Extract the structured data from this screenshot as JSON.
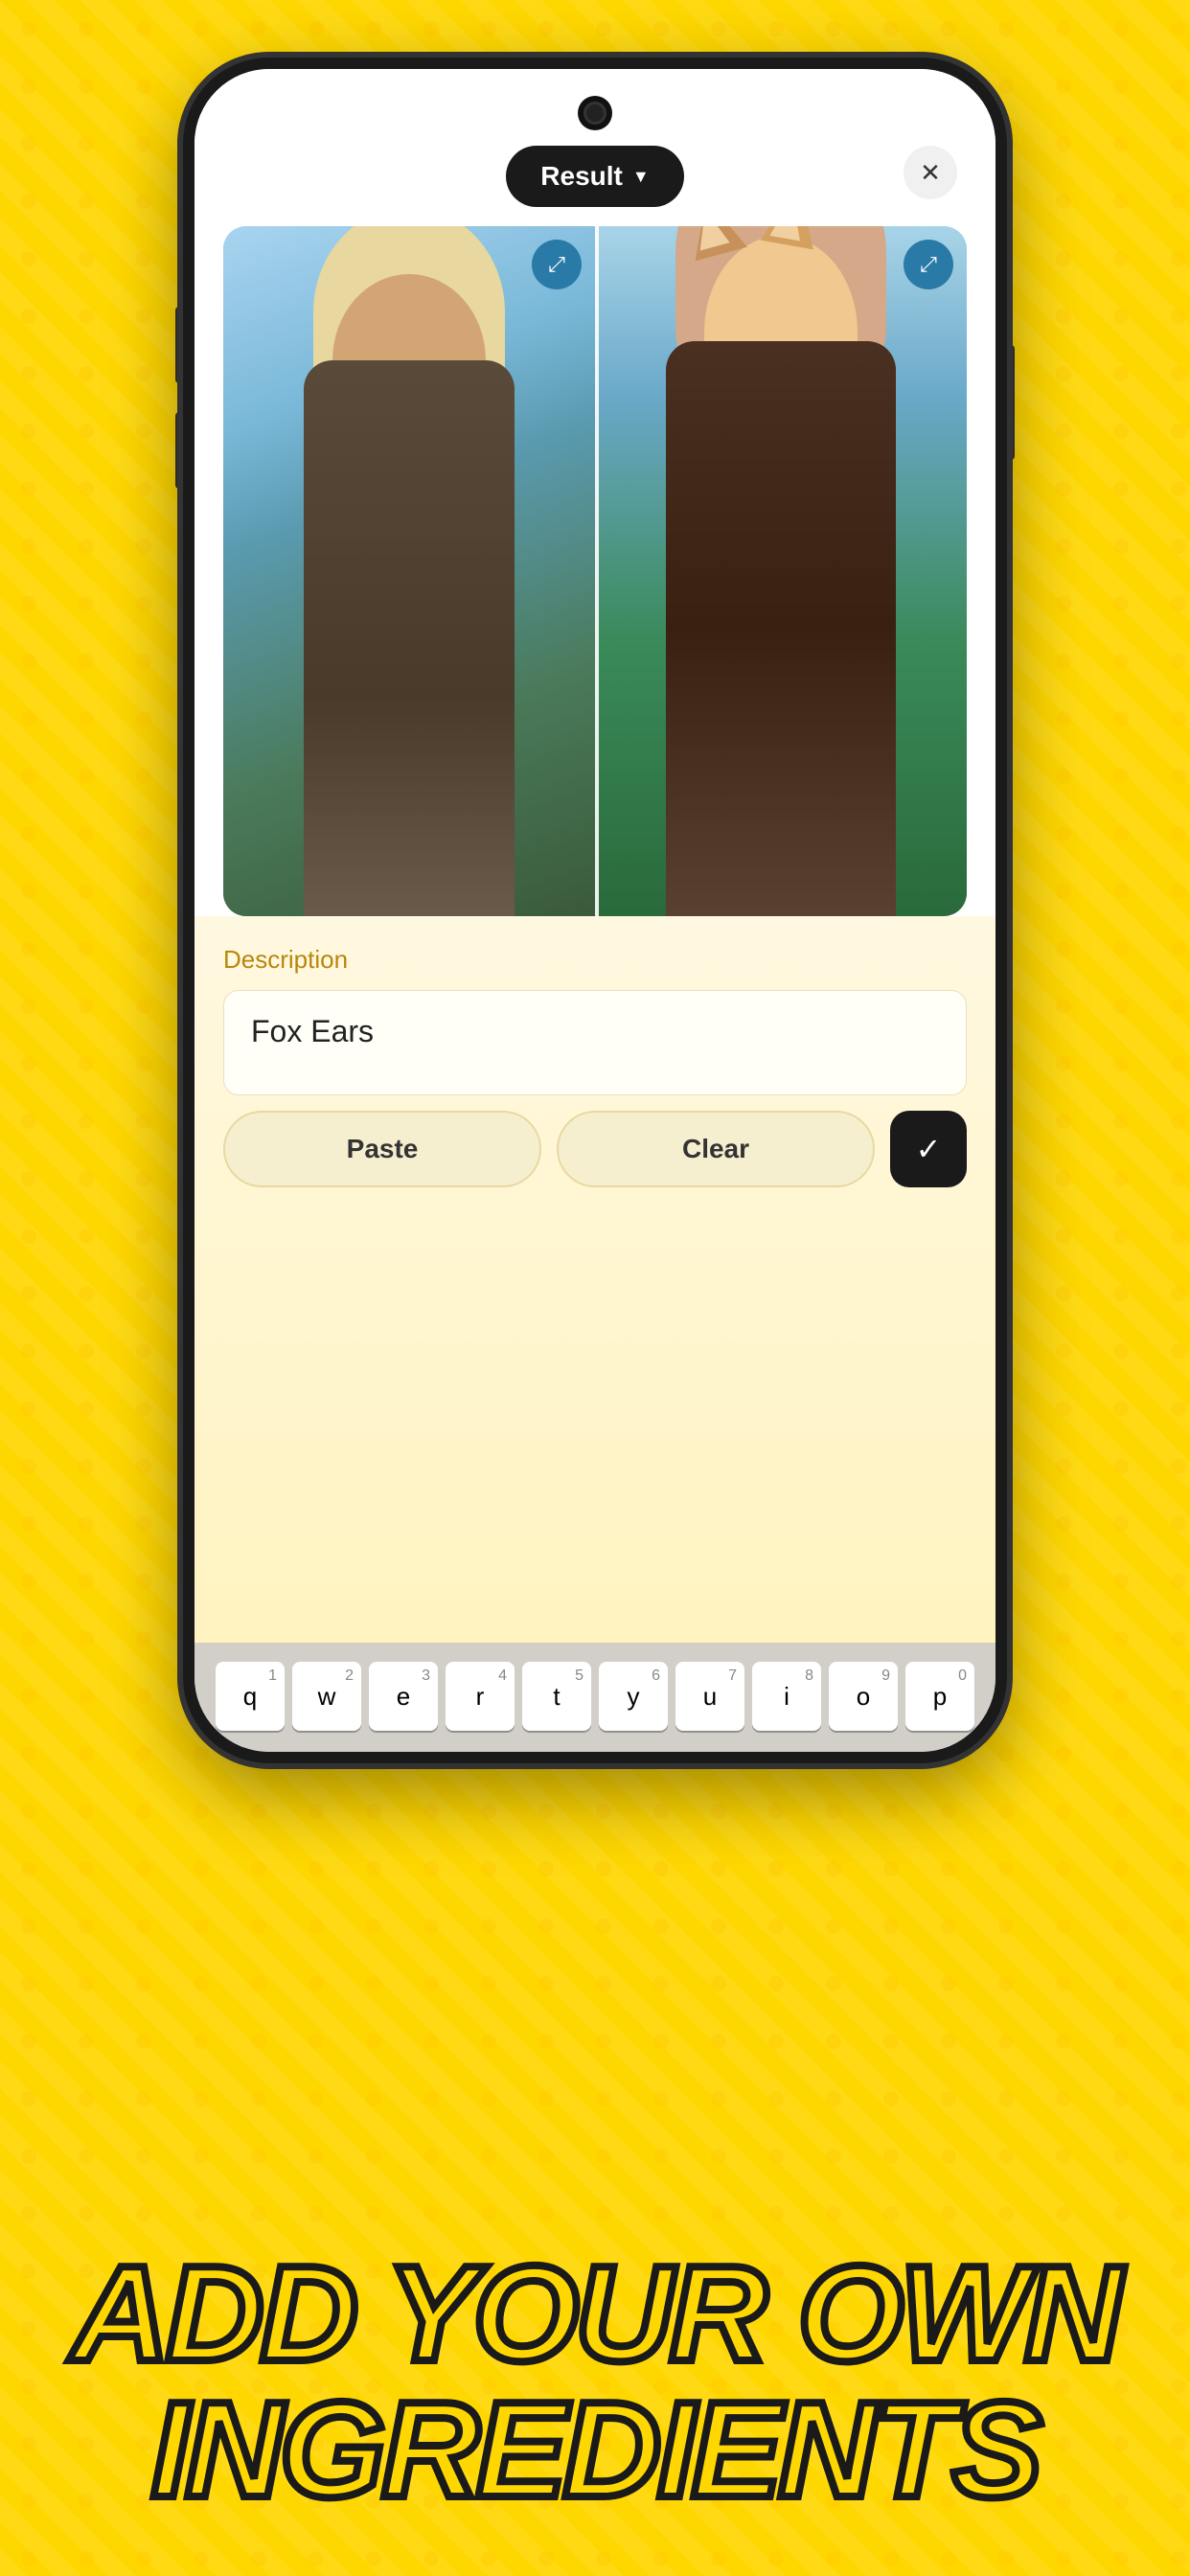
{
  "header": {
    "result_button_label": "Result",
    "close_button_label": "✕"
  },
  "image_area": {
    "move_icon": "⤢",
    "left_alt": "Original photo of girl outdoors",
    "right_alt": "Anime version with fox ears"
  },
  "description_section": {
    "label": "Description",
    "input_value": "Fox Ears",
    "paste_label": "Paste",
    "clear_label": "Clear",
    "confirm_icon": "✓"
  },
  "keyboard": {
    "rows": [
      {
        "keys": [
          {
            "letter": "q",
            "number": "1"
          },
          {
            "letter": "w",
            "number": "2"
          },
          {
            "letter": "e",
            "number": "3"
          },
          {
            "letter": "r",
            "number": "4"
          },
          {
            "letter": "t",
            "number": "5"
          },
          {
            "letter": "y",
            "number": "6"
          },
          {
            "letter": "u",
            "number": "7"
          },
          {
            "letter": "i",
            "number": "8"
          },
          {
            "letter": "o",
            "number": "9"
          },
          {
            "letter": "p",
            "number": "0"
          }
        ]
      }
    ]
  },
  "bottom_text": {
    "line1": "ADD YOUR OWN",
    "line2": "INGREDIENTS"
  },
  "colors": {
    "background": "#FFD700",
    "phone_frame": "#1a1a1a",
    "result_btn_bg": "#1a1a1a",
    "result_btn_text": "#ffffff",
    "description_label": "#b8860b",
    "keyboard_bg": "#d1cfc8",
    "bottom_text_fill": "#FFD700",
    "bottom_text_stroke": "#1a1a1a"
  }
}
